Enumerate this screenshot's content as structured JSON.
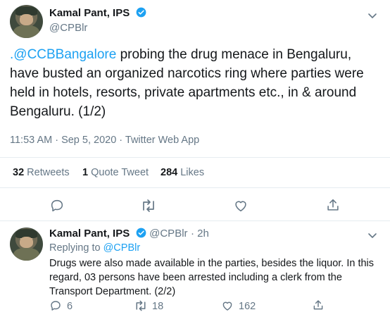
{
  "tweet": {
    "author_name": "Kamal Pant, IPS",
    "author_handle": "@CPBlr",
    "text_link": ".@CCBBangalore",
    "text_rest": " probing the drug menace in Bengaluru, have busted an organized narcotics ring where parties were held in hotels, resorts, private apartments etc., in & around Bengaluru. (1/2)",
    "timestamp": "11:53 AM · Sep 5, 2020 · Twitter Web App",
    "retweets_count": "32",
    "retweets_label": "Retweets",
    "quotes_count": "1",
    "quotes_label": "Quote Tweet",
    "likes_count": "284",
    "likes_label": "Likes",
    "icons": [
      "reply-icon",
      "retweet-icon",
      "like-icon",
      "share-icon"
    ]
  },
  "reply": {
    "author_name": "Kamal Pant, IPS",
    "author_handle": "@CPBlr",
    "age": "· 2h",
    "replying_to_prefix": "Replying to",
    "replying_to_handle": "@CPBlr",
    "text": "Drugs were also made available in the parties, besides the liquor. In this regard, 03 persons have been arrested including a clerk from the Transport Department. (2/2)",
    "reply_count": "6",
    "retweet_count": "18",
    "like_count": "162"
  },
  "colors": {
    "accent": "#1da1f2",
    "muted": "#657786",
    "text": "#14171a",
    "divider": "#e6ecf0"
  }
}
